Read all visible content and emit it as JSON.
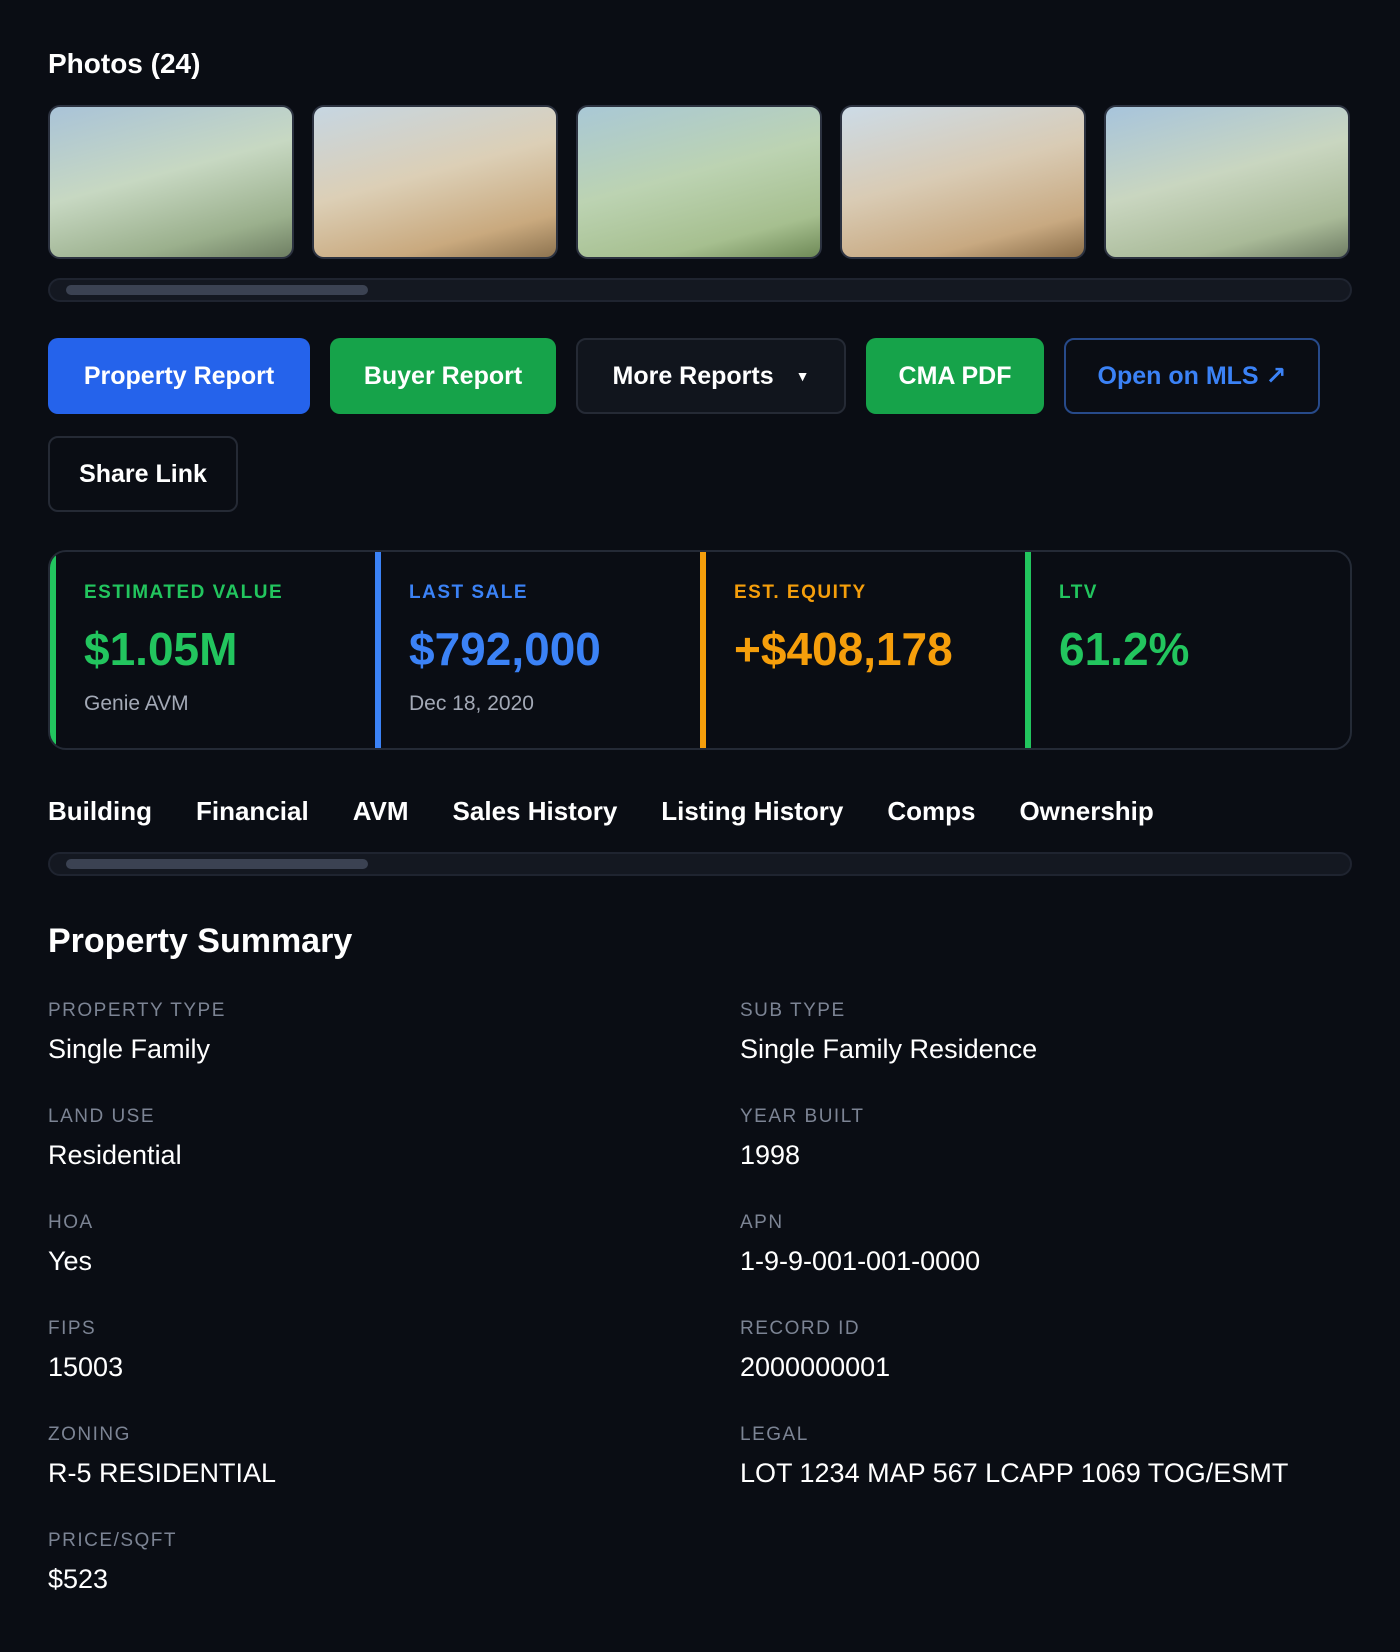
{
  "photos": {
    "title": "Photos (24)",
    "thumbnails": [
      "photo-1",
      "photo-2",
      "photo-3",
      "photo-4",
      "photo-5"
    ]
  },
  "actions": {
    "property_report": "Property Report",
    "buyer_report": "Buyer Report",
    "more_reports": "More Reports",
    "more_reports_caret": "▼",
    "cma_pdf": "CMA PDF",
    "open_mls": "Open on MLS ↗",
    "share_link": "Share Link"
  },
  "metrics": {
    "estimated_value": {
      "label": "ESTIMATED VALUE",
      "value": "$1.05M",
      "sub": "Genie AVM",
      "color": "#22c55e"
    },
    "last_sale": {
      "label": "LAST SALE",
      "value": "$792,000",
      "sub": "Dec 18, 2020",
      "color": "#3b82f6"
    },
    "est_equity": {
      "label": "EST. EQUITY",
      "value": "+$408,178",
      "sub": "",
      "color": "#f59e0b"
    },
    "ltv": {
      "label": "LTV",
      "value": "61.2%",
      "sub": "",
      "color": "#22c55e"
    }
  },
  "tabs": [
    "Building",
    "Financial",
    "AVM",
    "Sales History",
    "Listing History",
    "Comps",
    "Ownership"
  ],
  "summary": {
    "title": "Property Summary",
    "fields": [
      {
        "label": "PROPERTY TYPE",
        "value": "Single Family"
      },
      {
        "label": "SUB TYPE",
        "value": "Single Family Residence"
      },
      {
        "label": "LAND USE",
        "value": "Residential"
      },
      {
        "label": "YEAR BUILT",
        "value": "1998"
      },
      {
        "label": "HOA",
        "value": "Yes"
      },
      {
        "label": "APN",
        "value": "1-9-9-001-001-0000"
      },
      {
        "label": "FIPS",
        "value": "15003"
      },
      {
        "label": "RECORD ID",
        "value": "2000000001"
      },
      {
        "label": "ZONING",
        "value": "R-5 RESIDENTIAL"
      },
      {
        "label": "LEGAL",
        "value": "LOT 1234 MAP 567 LCAPP 1069 TOG/ESMT"
      },
      {
        "label": "PRICE/SQFT",
        "value": "$523"
      }
    ]
  },
  "colors": {
    "background": "#0a0d14",
    "primary_blue": "#2563eb",
    "success_green": "#16a34a",
    "accent_orange": "#f59e0b"
  }
}
